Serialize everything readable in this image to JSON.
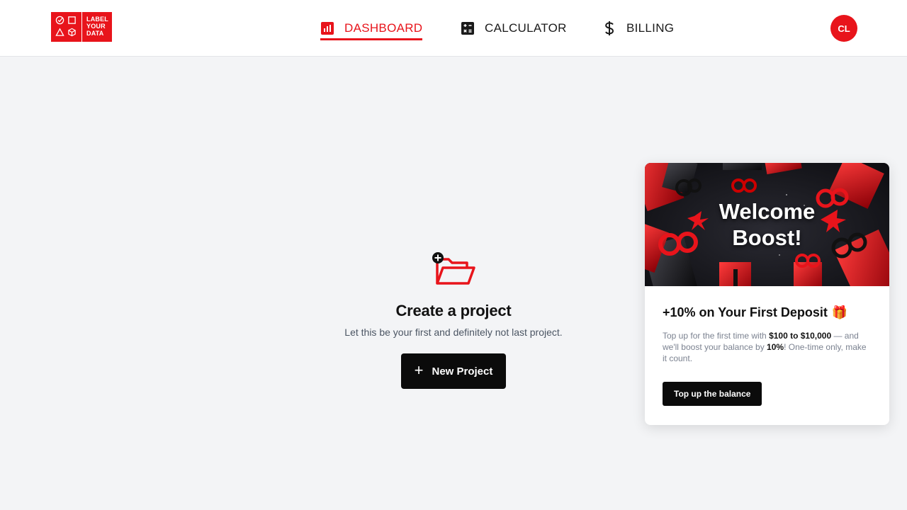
{
  "brand": {
    "logo_line1": "LABEL",
    "logo_line2": "YOUR",
    "logo_line3": "DATA",
    "accent": "#e8141b"
  },
  "nav": {
    "items": [
      {
        "label": "DASHBOARD",
        "icon": "bar-chart-icon",
        "active": true
      },
      {
        "label": "CALCULATOR",
        "icon": "calculator-icon",
        "active": false
      },
      {
        "label": "BILLING",
        "icon": "dollar-icon",
        "active": false
      }
    ]
  },
  "user": {
    "initials": "CL"
  },
  "empty_state": {
    "icon": "add-folder-icon",
    "title": "Create a project",
    "subtitle": "Let this be your first and definitely not last project.",
    "button_label": "New Project"
  },
  "promo": {
    "banner_title_line1": "Welcome",
    "banner_title_line2": "Boost!",
    "title": "+10% on Your First Deposit",
    "title_emoji": "🎁",
    "desc_part1": "Top up for the first time with ",
    "desc_bold1": "$100 to $10,000",
    "desc_part2": " — and we'll boost your balance by ",
    "desc_bold2": "10%",
    "desc_part3": "! One-time only, make it count.",
    "button_label": "Top up the balance"
  }
}
